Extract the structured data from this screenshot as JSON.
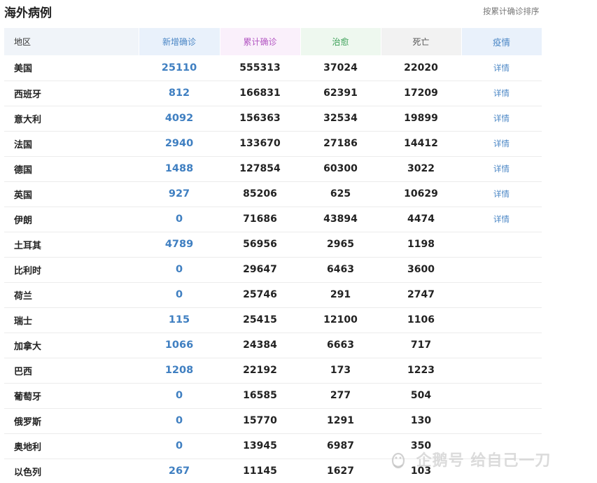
{
  "header": {
    "title": "海外病例",
    "sort_label": "按累计确诊排序"
  },
  "table": {
    "columns": {
      "region": "地区",
      "new": "新增确诊",
      "total": "累计确诊",
      "cured": "治愈",
      "dead": "死亡",
      "detail": "疫情"
    },
    "rows": [
      {
        "region": "美国",
        "new": "25110",
        "total": "555313",
        "cured": "37024",
        "dead": "22020",
        "detail": "详情"
      },
      {
        "region": "西班牙",
        "new": "812",
        "total": "166831",
        "cured": "62391",
        "dead": "17209",
        "detail": "详情"
      },
      {
        "region": "意大利",
        "new": "4092",
        "total": "156363",
        "cured": "32534",
        "dead": "19899",
        "detail": "详情"
      },
      {
        "region": "法国",
        "new": "2940",
        "total": "133670",
        "cured": "27186",
        "dead": "14412",
        "detail": "详情"
      },
      {
        "region": "德国",
        "new": "1488",
        "total": "127854",
        "cured": "60300",
        "dead": "3022",
        "detail": "详情"
      },
      {
        "region": "英国",
        "new": "927",
        "total": "85206",
        "cured": "625",
        "dead": "10629",
        "detail": "详情"
      },
      {
        "region": "伊朗",
        "new": "0",
        "total": "71686",
        "cured": "43894",
        "dead": "4474",
        "detail": "详情"
      },
      {
        "region": "土耳其",
        "new": "4789",
        "total": "56956",
        "cured": "2965",
        "dead": "1198",
        "detail": ""
      },
      {
        "region": "比利时",
        "new": "0",
        "total": "29647",
        "cured": "6463",
        "dead": "3600",
        "detail": ""
      },
      {
        "region": "荷兰",
        "new": "0",
        "total": "25746",
        "cured": "291",
        "dead": "2747",
        "detail": ""
      },
      {
        "region": "瑞士",
        "new": "115",
        "total": "25415",
        "cured": "12100",
        "dead": "1106",
        "detail": ""
      },
      {
        "region": "加拿大",
        "new": "1066",
        "total": "24384",
        "cured": "6663",
        "dead": "717",
        "detail": ""
      },
      {
        "region": "巴西",
        "new": "1208",
        "total": "22192",
        "cured": "173",
        "dead": "1223",
        "detail": ""
      },
      {
        "region": "葡萄牙",
        "new": "0",
        "total": "16585",
        "cured": "277",
        "dead": "504",
        "detail": ""
      },
      {
        "region": "俄罗斯",
        "new": "0",
        "total": "15770",
        "cured": "1291",
        "dead": "130",
        "detail": ""
      },
      {
        "region": "奥地利",
        "new": "0",
        "total": "13945",
        "cured": "6987",
        "dead": "350",
        "detail": ""
      },
      {
        "region": "以色列",
        "new": "267",
        "total": "11145",
        "cured": "1627",
        "dead": "103",
        "detail": ""
      }
    ]
  },
  "watermark": {
    "text": "企鹅号 给自己一刀",
    "icon": "penguin-logo-icon"
  },
  "colors": {
    "new_accent": "#3f7fc1",
    "total_accent": "#b356c2",
    "cured_accent": "#3a9f56",
    "link": "#4a86c5"
  }
}
